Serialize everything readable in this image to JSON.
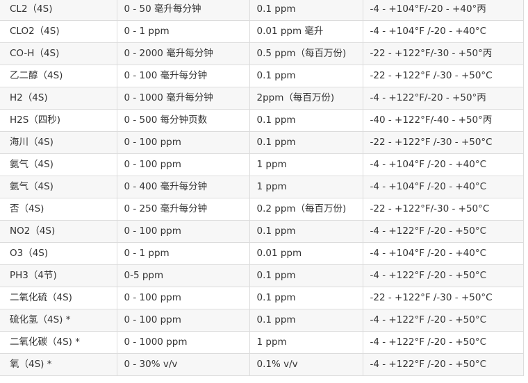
{
  "sensor_table": {
    "rows": [
      [
        "CL2（4S)",
        "0 - 50 毫升每分钟",
        "0.1 ppm",
        "-4 - +104°F/-20 - +40°丙"
      ],
      [
        "CLO2（4S)",
        "0 - 1 ppm",
        "0.01 ppm 毫升",
        "-4 - +104°F /-20 - +40°C"
      ],
      [
        "CO-H（4S)",
        "0 - 2000 毫升每分钟",
        "0.5 ppm（每百万份)",
        "-22 - +122°F/-30 - +50°丙"
      ],
      [
        "乙二醇（4S)",
        "0 - 100 毫升每分钟",
        "0.1 ppm",
        "-22 - +122°F /-30 - +50°C"
      ],
      [
        "H2（4S)",
        "0 - 1000 毫升每分钟",
        "2ppm（每百万份)",
        "-4 - +122°F/-20 - +50°丙"
      ],
      [
        "H2S（四秒)",
        "0 - 500 每分钟页数",
        "0.1 ppm",
        "-40 - +122°F/-40 - +50°丙"
      ],
      [
        "海川（4S)",
        "0 - 100 ppm",
        "0.1 ppm",
        "-22 - +122°F /-30 - +50°C"
      ],
      [
        "氨气（4S)",
        "0 - 100 ppm",
        "1 ppm",
        "-4 - +104°F /-20 - +40°C"
      ],
      [
        "氨气（4S)",
        "0 - 400 毫升每分钟",
        "1 ppm",
        "-4 - +104°F /-20 - +40°C"
      ],
      [
        "否（4S)",
        "0 - 250 毫升每分钟",
        "0.2 ppm（每百万份)",
        "-22 - +122°F/-30 - +50°C"
      ],
      [
        "NO2（4S)",
        "0 - 100 ppm",
        "0.1 ppm",
        "-4 - +122°F /-20 - +50°C"
      ],
      [
        "O3（4S)",
        "0 - 1 ppm",
        "0.01 ppm",
        "-4 - +104°F /-20 - +40°C"
      ],
      [
        "PH3（4节)",
        "0-5 ppm",
        "0.1 ppm",
        "-4 - +122°F /-20 - +50°C"
      ],
      [
        "二氧化硫（4S)",
        "0 - 100 ppm",
        "0.1 ppm",
        "-22 - +122°F /-30 - +50°C"
      ],
      [
        "硫化氢（4S) *",
        "0 - 100 ppm",
        "0.1 ppm",
        "-4 - +122°F /-20 - +50°C"
      ],
      [
        "二氧化碳（4S) *",
        "0 - 1000 ppm",
        "1 ppm",
        "-4 - +122°F /-20 - +50°C"
      ],
      [
        "氧（4S) *",
        "0 - 30% v/v",
        "0.1% v/v",
        "-4 - +122°F /-20 - +50°C"
      ]
    ]
  }
}
